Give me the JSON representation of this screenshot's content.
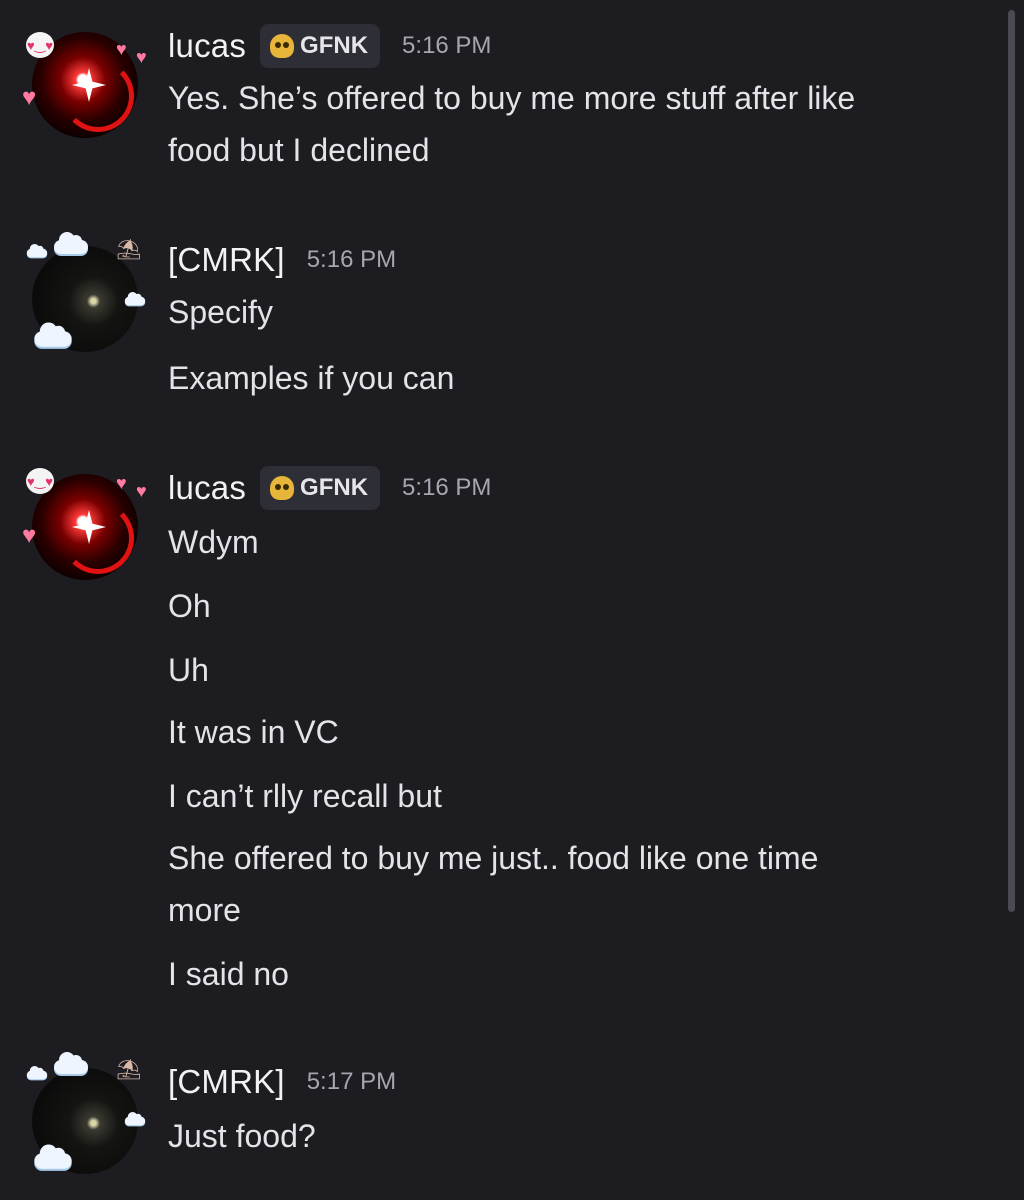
{
  "messages": [
    {
      "author": "lucas",
      "tag": "GFNK",
      "time": "5:16 PM",
      "lines": [
        "Yes. She’s offered to buy me more stuff after like",
        "food but I declined"
      ]
    },
    {
      "author": "[CMRK]",
      "time": "5:16 PM",
      "lines": [
        "Specify",
        "Examples if you can"
      ]
    },
    {
      "author": "lucas",
      "tag": "GFNK",
      "time": "5:16 PM",
      "lines": [
        "Wdym",
        "Oh",
        "Uh",
        "It was in VC",
        "I can’t rlly recall but",
        "She offered to buy me just.. food like one time",
        "more",
        "I said no"
      ]
    },
    {
      "author": "[CMRK]",
      "time": "5:17 PM",
      "lines": [
        "Just food?"
      ]
    }
  ],
  "colors": {
    "background": "#1c1c21",
    "tag_bg": "#2e2f36",
    "timestamp": "#a5a6b0"
  }
}
